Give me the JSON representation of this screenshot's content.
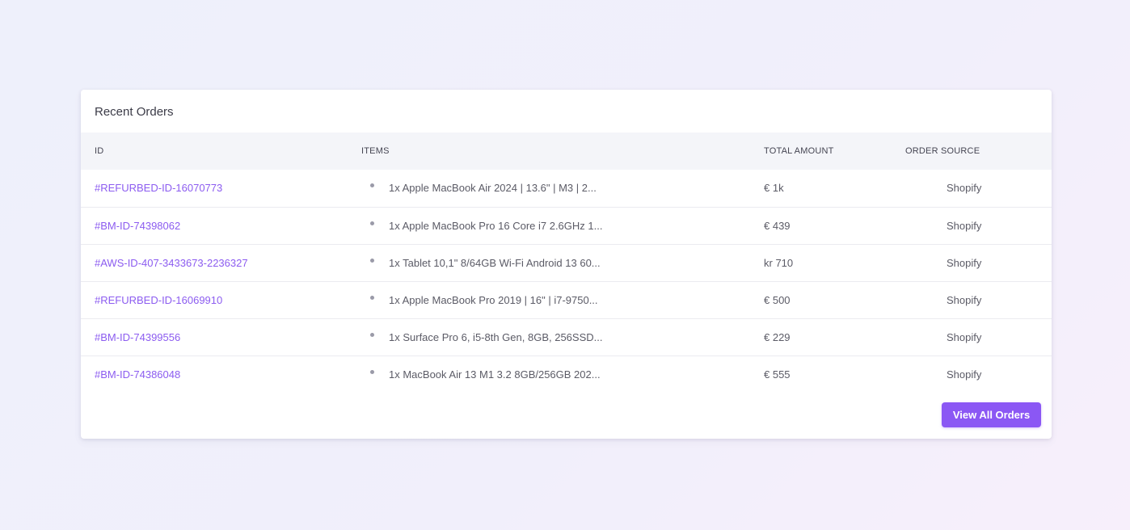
{
  "card": {
    "title": "Recent Orders"
  },
  "table": {
    "headers": {
      "id": "ID",
      "items": "ITEMS",
      "total": "TOTAL AMOUNT",
      "source": "ORDER SOURCE"
    },
    "rows": [
      {
        "id": "#REFURBED-ID-16070773",
        "item": "1x Apple MacBook Air 2024 | 13.6\" | M3 | 2...",
        "total": "€ 1k",
        "source": "Shopify"
      },
      {
        "id": "#BM-ID-74398062",
        "item": "1x Apple MacBook Pro 16 Core i7 2.6GHz 1...",
        "total": "€ 439",
        "source": "Shopify"
      },
      {
        "id": "#AWS-ID-407-3433673-2236327",
        "item": "1x Tablet 10,1\" 8/64GB Wi-Fi Android 13 60...",
        "total": "kr 710",
        "source": "Shopify"
      },
      {
        "id": "#REFURBED-ID-16069910",
        "item": "1x Apple MacBook Pro 2019 | 16\" | i7-9750...",
        "total": "€ 500",
        "source": "Shopify"
      },
      {
        "id": "#BM-ID-74399556",
        "item": "1x Surface Pro 6, i5-8th Gen, 8GB, 256SSD...",
        "total": "€ 229",
        "source": "Shopify"
      },
      {
        "id": "#BM-ID-74386048",
        "item": "1x MacBook Air 13 M1 3.2 8GB/256GB 202...",
        "total": "€ 555",
        "source": "Shopify"
      }
    ]
  },
  "actions": {
    "view_all_label": "View All Orders"
  },
  "colors": {
    "accent": "#8b57f4",
    "link": "#8c5cf0",
    "header_bg": "#f4f5f9"
  },
  "icons": {
    "item_bullet": "bullet-dot-icon"
  }
}
